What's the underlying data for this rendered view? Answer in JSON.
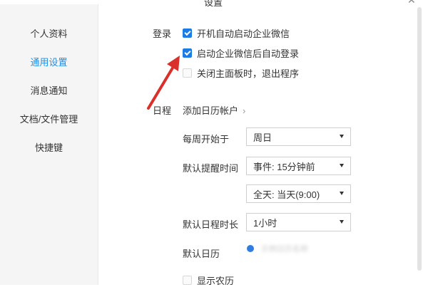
{
  "window": {
    "title": "设置"
  },
  "sidebar": {
    "items": [
      {
        "label": "个人资料",
        "active": false
      },
      {
        "label": "通用设置",
        "active": true
      },
      {
        "label": "消息通知",
        "active": false
      },
      {
        "label": "文档/文件管理",
        "active": false
      },
      {
        "label": "快捷键",
        "active": false
      }
    ]
  },
  "login": {
    "section_label": "登录",
    "options": [
      {
        "label": "开机自动启动企业微信",
        "checked": true
      },
      {
        "label": "启动企业微信后自动登录",
        "checked": true
      },
      {
        "label": "关闭主面板时，退出程序",
        "checked": false
      }
    ]
  },
  "schedule": {
    "section_label": "日程",
    "add_account_link": "添加日历帐户",
    "week_start": {
      "label": "每周开始于",
      "value": "周日"
    },
    "default_reminder": {
      "label": "默认提醒时间",
      "value": "事件: 15分钟前"
    },
    "all_day_reminder": {
      "value": "全天: 当天(9:00)"
    },
    "default_duration": {
      "label": "默认日程时长",
      "value": "1小时"
    },
    "default_calendar": {
      "label": "默认日历",
      "value": "示例日历名称"
    },
    "show_lunar": {
      "label": "显示农历",
      "checked": false
    }
  },
  "colors": {
    "accent": "#1f8fe8",
    "checkbox": "#1c7ce6",
    "arrow": "#d9302b"
  }
}
